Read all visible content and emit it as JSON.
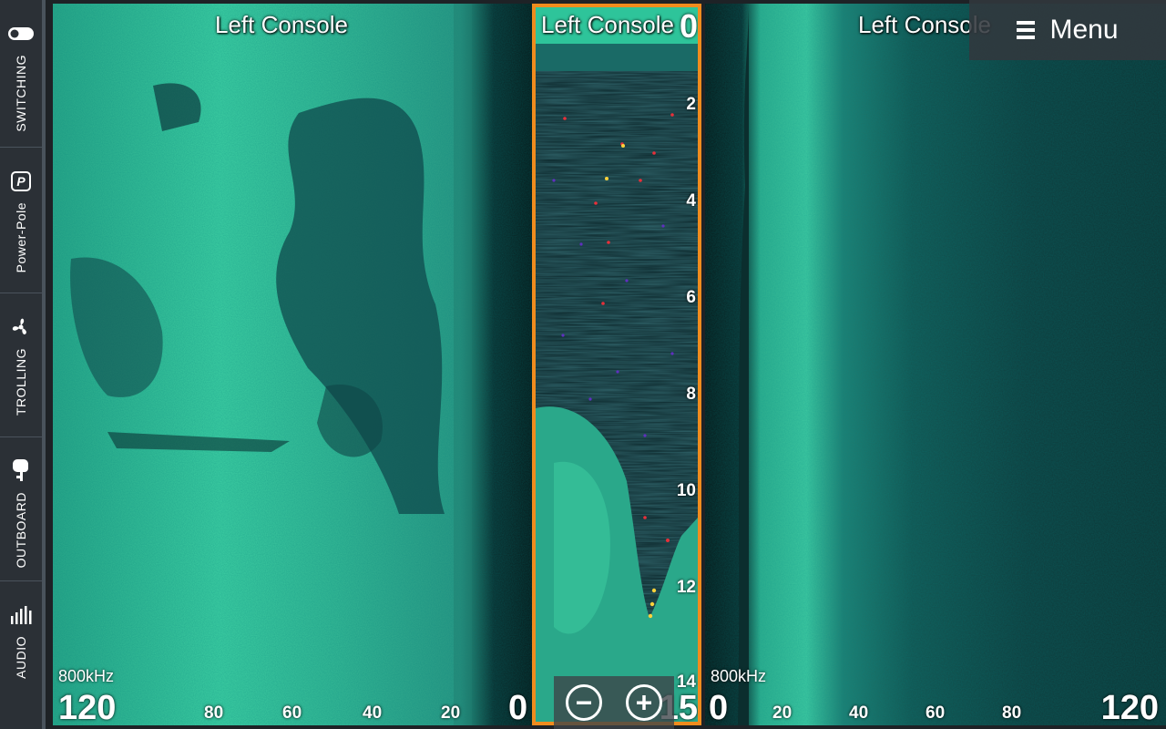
{
  "sidebar": {
    "items": [
      {
        "label": "SWITCHING",
        "icon": "toggle-switch-icon"
      },
      {
        "label": "Power-Pole",
        "icon": "power-pole-icon"
      },
      {
        "label": "TROLLING",
        "icon": "propeller-icon"
      },
      {
        "label": "OUTBOARD",
        "icon": "outboard-motor-icon"
      },
      {
        "label": "AUDIO",
        "icon": "audio-levels-icon"
      }
    ]
  },
  "menu": {
    "label": "Menu",
    "icon": "hamburger-icon"
  },
  "panels": {
    "left": {
      "title": "Left Console",
      "frequency": "800kHz",
      "range_max": "120",
      "range_zero": "0",
      "ticks": [
        "80",
        "60",
        "40",
        "20"
      ]
    },
    "middle": {
      "title": "Left Console",
      "depth_top": "0",
      "depth_ticks": [
        "2",
        "4",
        "6",
        "8",
        "10",
        "12",
        "14"
      ],
      "depth_bottom": "15"
    },
    "right": {
      "title": "Left Console",
      "frequency": "800kHz",
      "range_zero": "0",
      "range_max": "120",
      "ticks": [
        "20",
        "40",
        "60",
        "80"
      ]
    }
  },
  "zoom": {
    "out_icon": "zoom-out-icon",
    "in_icon": "zoom-in-icon"
  },
  "colors": {
    "accent": "#f08c1e",
    "sonar": "#3ed0a2",
    "sidebar": "#2b3036"
  }
}
